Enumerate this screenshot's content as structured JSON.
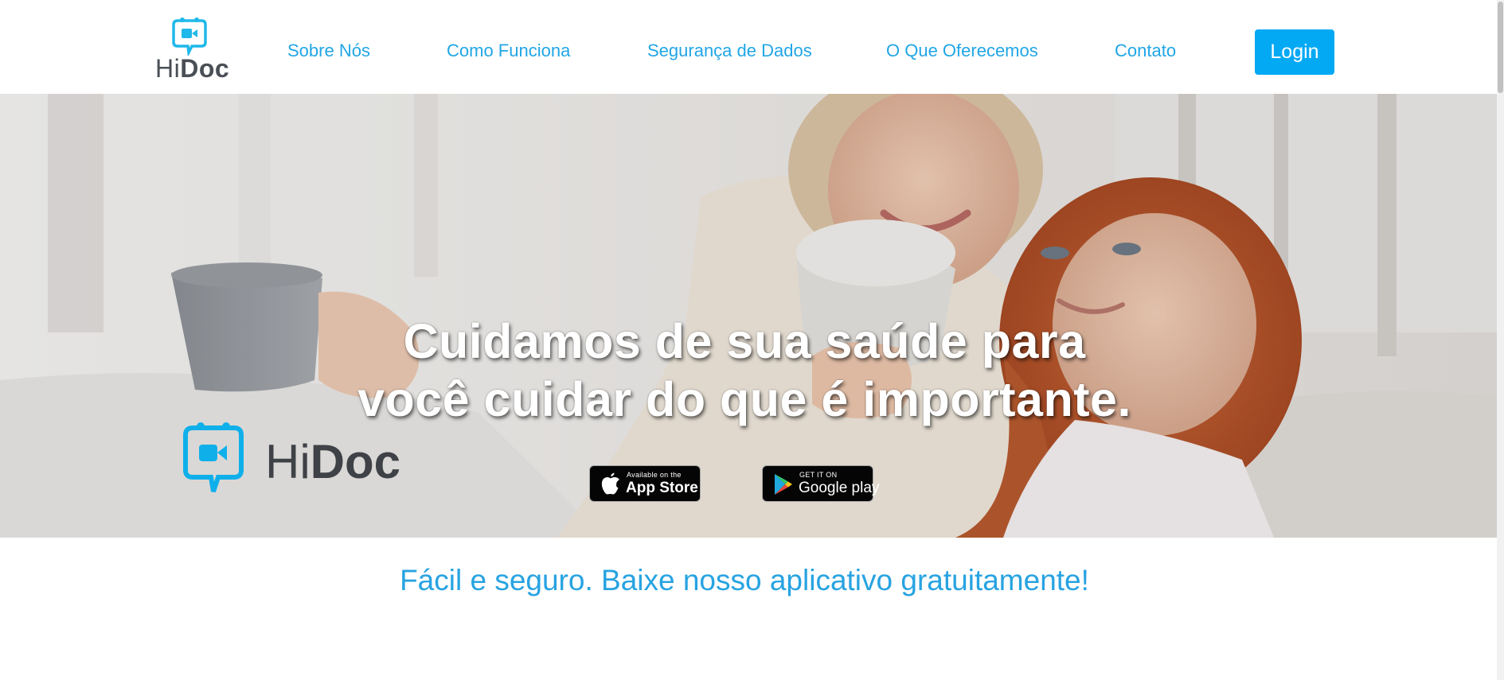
{
  "header": {
    "logo": {
      "text_light": "Hi",
      "text_bold": "Doc",
      "icon": "video-chat-bubble-icon"
    },
    "nav": [
      {
        "label": "Sobre Nós"
      },
      {
        "label": "Como Funciona"
      },
      {
        "label": "Segurança de Dados"
      },
      {
        "label": "O Que Oferecemos"
      },
      {
        "label": "Contato"
      }
    ],
    "login_label": "Login"
  },
  "hero": {
    "title_line1": "Cuidamos de sua saúde para",
    "title_line2": "você cuidar do que é importante.",
    "logo": {
      "text_light": "Hi",
      "text_bold": "Doc",
      "icon": "video-chat-bubble-icon"
    },
    "app_store": {
      "small": "Available on the",
      "big": "App Store",
      "icon": "apple-icon"
    },
    "google_play": {
      "small": "GET IT ON",
      "big": "Google play",
      "icon": "google-play-icon"
    }
  },
  "tagline": "Fácil e seguro. Baixe nosso aplicativo gratuitamente!",
  "colors": {
    "accent": "#04a9f4",
    "link": "#21a6e6",
    "logo_icon": "#1fb8ea",
    "logo_text": "#4a4f55"
  }
}
